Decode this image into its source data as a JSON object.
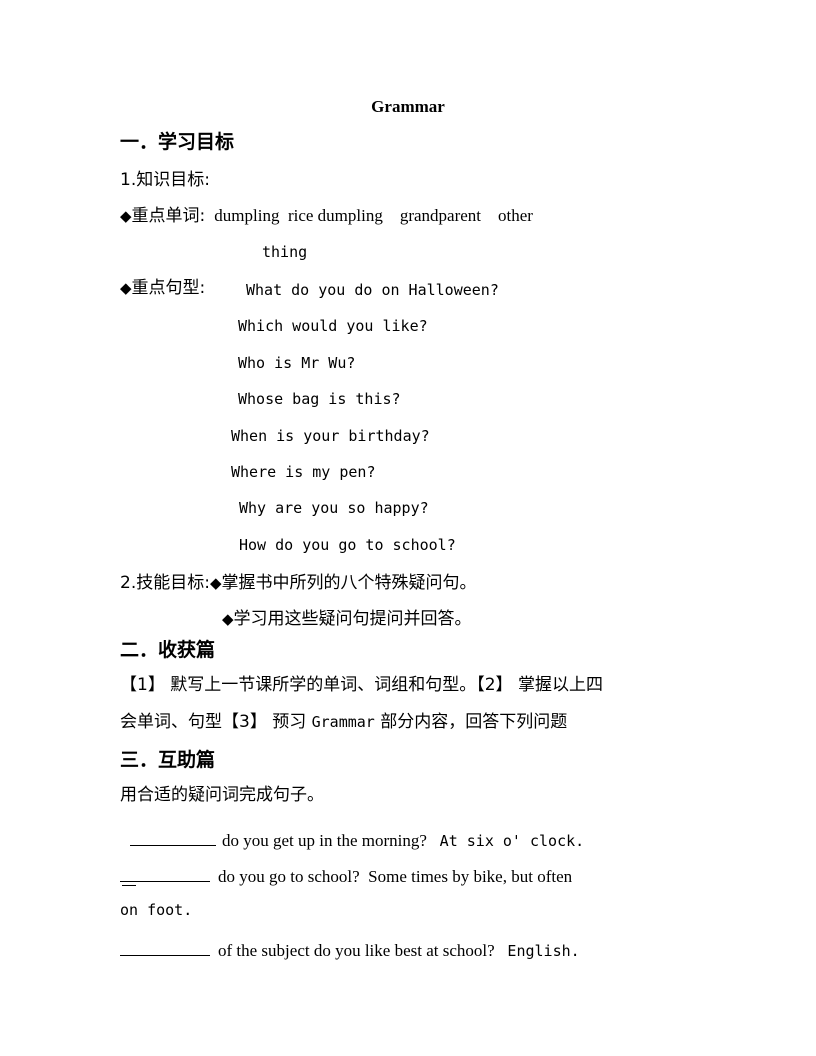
{
  "document": {
    "title": "Grammar"
  },
  "section1": {
    "heading": "一．学习目标",
    "sub1_label": "1.知识目标:",
    "vocab_row": {
      "bullet": "◆",
      "label": "重点单词:",
      "words": "dumpling  rice dumpling    grandparent    other",
      "words_wrap": "thing"
    },
    "patterns_row": {
      "bullet": "◆",
      "label": "重点句型:"
    },
    "patterns": [
      "What do you do on Halloween?",
      "Which would you like?",
      "Who is Mr Wu?",
      "Whose bag is this?",
      "When is your birthday?",
      "Where is my pen?",
      "Why are you so happy?",
      "How do you go to school?"
    ],
    "sub2_label": "2.技能目标:",
    "skills": [
      {
        "bullet": "◆",
        "text": "掌握书中所列的八个特殊疑问句。"
      },
      {
        "bullet": "◆",
        "text": "学习用这些疑问句提问并回答。"
      }
    ]
  },
  "section2": {
    "heading": "二．收获篇",
    "body_line1": "【1】 默写上一节课所学的单词、词组和句型。【2】 掌握以上四",
    "body_line2_a": "会单词、句型【3】 预习 ",
    "body_line2_b": "Grammar",
    "body_line2_c": " 部分内容，回答下列问题"
  },
  "section3": {
    "heading": "三．互助篇",
    "instruction": "用合适的疑问词完成句子。",
    "questions": [
      {
        "blank": "__________",
        "question": "do you get up in the morning?",
        "gap": "   ",
        "answer": "At six o' clock."
      },
      {
        "blank": "__________",
        "question": "do you go to school?",
        "gap": "  ",
        "answer": "Some times by bike, but often",
        "continuation": "on foot."
      },
      {
        "blank": "__________",
        "question": "of the subject do you like best at school?",
        "gap": "   ",
        "answer": "English."
      }
    ]
  }
}
